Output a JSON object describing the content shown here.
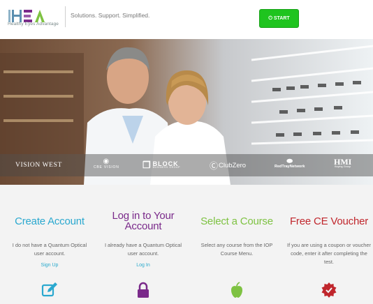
{
  "header": {
    "logo_text": "HEA",
    "logo_subtitle": "Healthy Eyes Advantage",
    "tagline": "Solutions. Support. Simplified.",
    "start_button": "START",
    "start_icon": "power-icon"
  },
  "hero": {
    "partners": [
      {
        "name": "VISION WEST"
      },
      {
        "name": "CBE VISION"
      },
      {
        "name": "BLOCK",
        "sub": "BUSINESS GROUP"
      },
      {
        "name": "ClubZero"
      },
      {
        "name": "RedTrayNetwork"
      },
      {
        "name": "HMI",
        "sub": "Buying Group"
      }
    ]
  },
  "features": [
    {
      "title": "Create Account",
      "title_color": "#2aa8cf",
      "description": "I do not have a Quantum Optical user account.",
      "link": "Sign Up",
      "icon": "edit-icon",
      "icon_color": "#2aa8cf"
    },
    {
      "title": "Log in to Your Account",
      "title_color": "#7a2a8a",
      "description": "I already have a Quantum Optical user account.",
      "link": "Log In",
      "icon": "lock-icon",
      "icon_color": "#7a2a8a"
    },
    {
      "title": "Select a Course",
      "title_color": "#7ec242",
      "description": "Select any course from the IOP Course Menu.",
      "link": "",
      "icon": "apple-icon",
      "icon_color": "#7ec242"
    },
    {
      "title": "Free CE Voucher",
      "title_color": "#c0262c",
      "description": "If you are using a coupon or voucher code, enter it after completing the test.",
      "link": "",
      "icon": "badge-icon",
      "icon_color": "#c0262c"
    }
  ]
}
